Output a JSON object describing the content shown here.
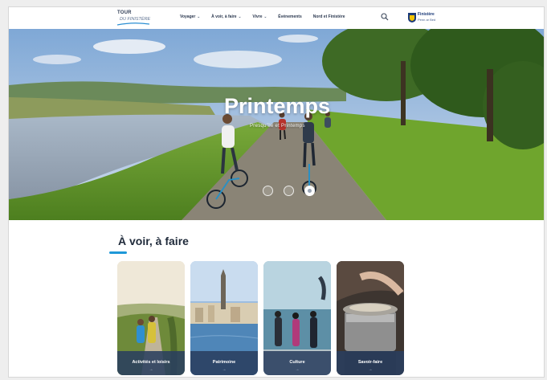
{
  "header": {
    "logo_line1": "TOUR",
    "logo_line2": "DU FINISTÈRE",
    "nav": [
      {
        "label": "Voyager",
        "has_menu": true
      },
      {
        "label": "À voir, à faire",
        "has_menu": true
      },
      {
        "label": "Vivre",
        "has_menu": true
      },
      {
        "label": "Événements",
        "has_menu": false
      },
      {
        "label": "Nord et Finistère",
        "has_menu": false
      }
    ],
    "brand_line1": "Finistère",
    "brand_line2": "Penn ar Bed",
    "chevron": "⌄"
  },
  "hero": {
    "title": "Printemps",
    "subtitle": "Presqu'île et Printemps",
    "slides": 3,
    "active_slide": 3
  },
  "section": {
    "title": "À voir, à faire",
    "accent_color": "#1e98d8",
    "cards": [
      {
        "label": "Activités et loisirs",
        "arrow": "→"
      },
      {
        "label": "Patrimoine",
        "arrow": "→"
      },
      {
        "label": "Culture",
        "arrow": "→"
      },
      {
        "label": "Savoir-faire",
        "arrow": "→"
      }
    ]
  }
}
